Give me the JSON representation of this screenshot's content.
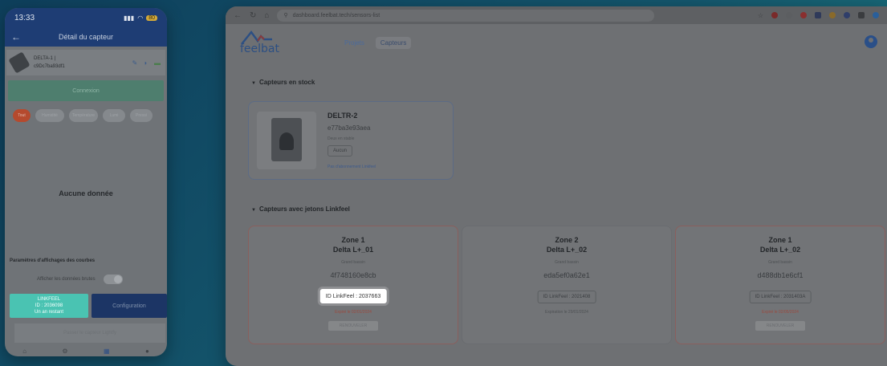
{
  "phone": {
    "status": {
      "time": "13:33",
      "battery": "80"
    },
    "header": {
      "title": "Détail du capteur"
    },
    "device": {
      "name": "DELTA-1 |",
      "id": "c9Dc7ba93df1"
    },
    "connect_label": "Connexion",
    "chips": [
      "Tout",
      "Humidité",
      "Température",
      "Lumi",
      "Pressi"
    ],
    "empty_label": "Aucune donnée",
    "params_title": "Paramètres d'affichages des courbes",
    "raw_toggle_label": "Afficher les données brutes",
    "linkfeel": {
      "line1": "LINKFEEL",
      "line2": "ID : 2036098",
      "line3": "Un an restant"
    },
    "config_label": "Configuration",
    "bottom_button": "Passer le capteur Lightfy",
    "tabs": [
      "home-icon",
      "settings-icon",
      "sensor-icon",
      "profile-icon"
    ]
  },
  "browser": {
    "url": "dashboard.feelbat.tech/sensors-list",
    "logo_text": "feelbat",
    "nav": [
      "Projets",
      "Capteurs"
    ],
    "active_nav": "Capteurs",
    "colors": {
      "accent_red": "#c0392b",
      "brand_blue": "#2c4f83"
    }
  },
  "stock_section": {
    "title": "Capteurs en stock",
    "sensor": {
      "name": "DELTR-2",
      "id": "e77ba3e93aea",
      "sub": "Deux en stable",
      "pill": "Aucun",
      "link": "Pas d'abonnement Linkfeel"
    }
  },
  "linkfeel_section": {
    "title": "Capteurs avec jetons Linkfeel",
    "cards": [
      {
        "zone": "Zone 1",
        "name": "Delta L+_01",
        "sub": "Grand bassin",
        "id": "4f748160e8cb",
        "link_id": "ID LinkFeel : 2037663",
        "expiry": "Expiré le 02/01/2024",
        "renew": "RENOUVELER"
      },
      {
        "zone": "Zone 2",
        "name": "Delta L+_02",
        "sub": "Grand bassin",
        "id": "eda5ef0a62e1",
        "link_id": "ID LinkFeel : 2021408",
        "expiry": "Expiration le 29/01/2024",
        "renew": ""
      },
      {
        "zone": "Zone 1",
        "name": "Delta L+_02",
        "sub": "Grand bassin",
        "id": "d488db1e6cf1",
        "link_id": "ID LinkFeel : 2031403A",
        "expiry": "Expiré le 02/05/2024",
        "renew": "RENOUVELER"
      }
    ]
  }
}
